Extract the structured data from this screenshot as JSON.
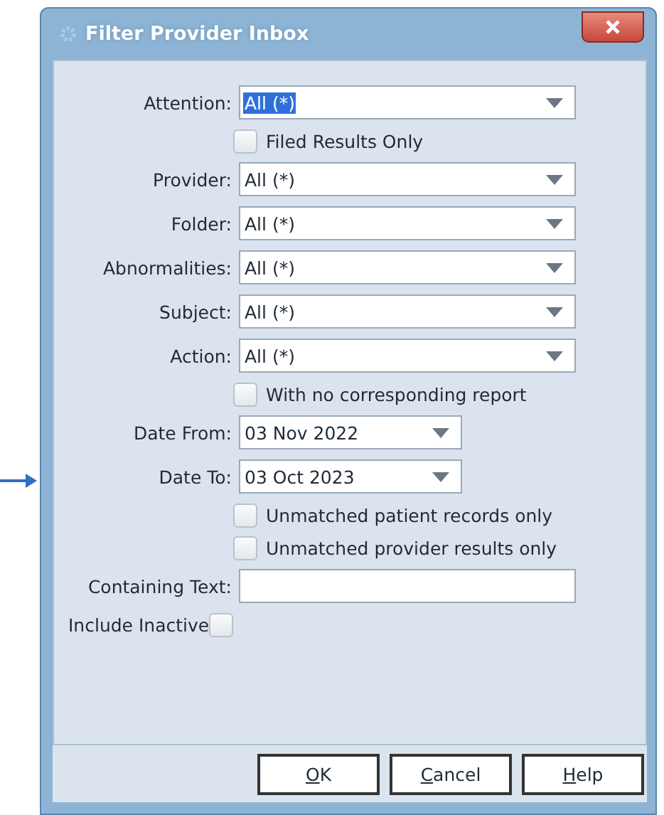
{
  "window": {
    "title": "Filter Provider Inbox"
  },
  "fields": [
    {
      "kind": "select",
      "label": "Attention:",
      "value": "All (*)",
      "text_selected": true
    },
    {
      "kind": "checkbox",
      "label": "Filed Results Only",
      "checked": false
    },
    {
      "kind": "select",
      "label": "Provider:",
      "value": "All (*)",
      "text_selected": false
    },
    {
      "kind": "select",
      "label": "Folder:",
      "value": "All (*)",
      "text_selected": false
    },
    {
      "kind": "select",
      "label": "Abnormalities:",
      "value": "All (*)",
      "text_selected": false
    },
    {
      "kind": "select",
      "label": "Subject:",
      "value": "All (*)",
      "text_selected": false
    },
    {
      "kind": "select",
      "label": "Action:",
      "value": "All (*)",
      "text_selected": false
    },
    {
      "kind": "checkbox",
      "label": "With no corresponding report",
      "checked": false
    },
    {
      "kind": "date",
      "label": "Date From:",
      "value": "03 Nov 2022"
    },
    {
      "kind": "date",
      "label": "Date To:",
      "value": "03 Oct 2023"
    },
    {
      "kind": "checkbox",
      "label": "Unmatched patient records only",
      "checked": false
    },
    {
      "kind": "checkbox",
      "label": "Unmatched provider results only",
      "checked": false
    },
    {
      "kind": "text",
      "label": "Containing Text:"
    },
    {
      "kind": "inline_checkbox",
      "label": "Include Inactive",
      "checked": false
    }
  ],
  "buttons": [
    {
      "access_key": "O",
      "label_rest": "K"
    },
    {
      "access_key": "C",
      "label_rest": "ancel"
    },
    {
      "access_key": "H",
      "label_rest": "elp"
    }
  ]
}
